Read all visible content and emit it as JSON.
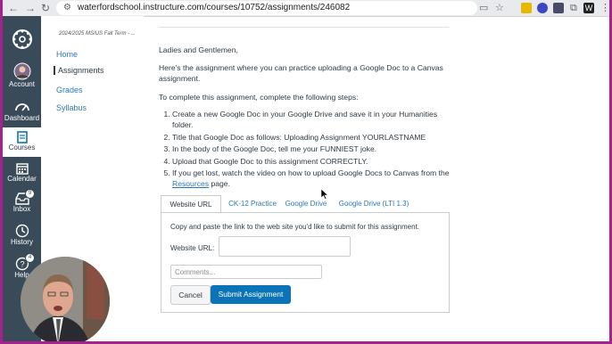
{
  "browser": {
    "url": "waterfordschool.instructure.com/courses/10752/assignments/246082",
    "nav_back": "←",
    "nav_forward": "→",
    "nav_reload": "↻"
  },
  "global_nav": {
    "items": [
      {
        "label": "Account"
      },
      {
        "label": "Dashboard"
      },
      {
        "label": "Courses"
      },
      {
        "label": "Calendar"
      },
      {
        "label": "Inbox",
        "badge": "9"
      },
      {
        "label": "History"
      },
      {
        "label": "Help",
        "badge": "4"
      }
    ]
  },
  "course_nav": {
    "term": "2024/2025 MS/US Fall Term - ...",
    "items": [
      "Home",
      "Assignments",
      "Grades",
      "Syllabus"
    ]
  },
  "assignment": {
    "greeting": "Ladies and Gentlemen,",
    "intro": "Here's the assignment where you can practice uploading a Google Doc to a Canvas assignment.",
    "steps_intro": "To complete this assignment, complete the following steps:",
    "steps": [
      "Create a new Google Doc in your Google Drive and save it in your Humanities folder.",
      "Title that Google Doc as follows: Uploading Assignment YOURLASTNAME",
      "In the body of the Google Doc, tell me your FUNNIEST joke.",
      "Upload that Google Doc to this assignment CORRECTLY."
    ],
    "step5_pre": "If you get lost, watch the video on how to upload Google Docs to Canvas from the ",
    "step5_link": "Resources",
    "step5_post": " page."
  },
  "submission": {
    "tabs": [
      "Website URL",
      "CK-12 Practice",
      "Google Drive",
      "Google Drive (LTI 1.3)"
    ],
    "active_tab": "Website URL",
    "description": "Copy and paste the link to the web site you'd like to submit for this assignment.",
    "url_label": "Website URL:",
    "url_value": "",
    "comments_placeholder": "Comments...",
    "cancel_label": "Cancel",
    "submit_label": "Submit Assignment"
  },
  "colors": {
    "canvas_nav": "#394b58",
    "link": "#2b7abc",
    "submit": "#0b74b7",
    "border_frame": "#a2228e"
  }
}
